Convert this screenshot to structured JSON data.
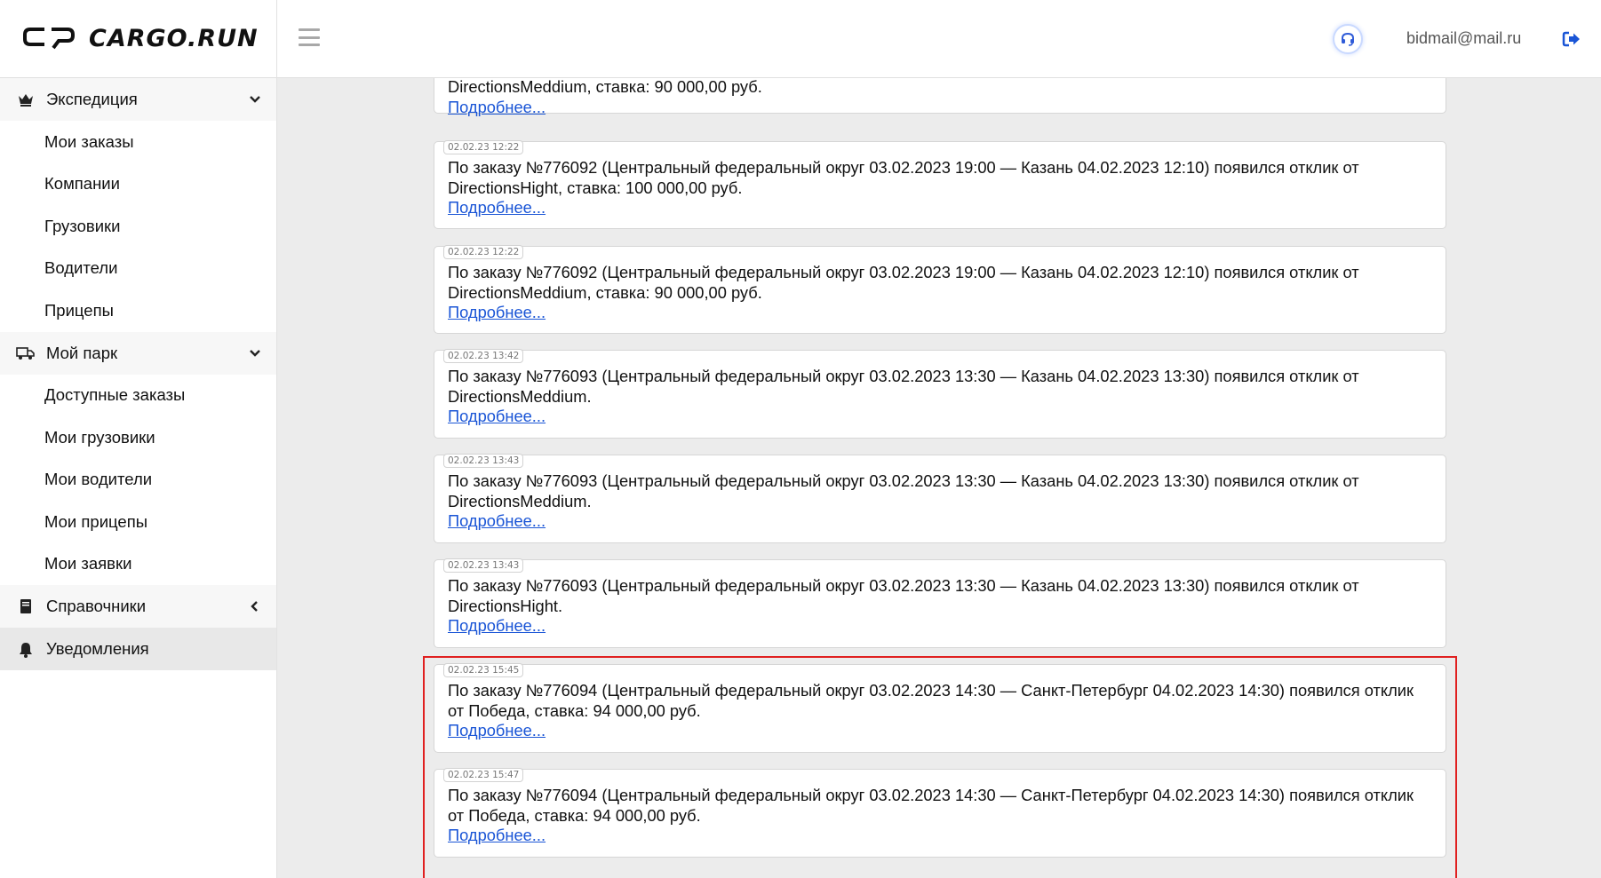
{
  "header": {
    "logo_text": "CARGO.RUN",
    "user_email": "bidmail@mail.ru",
    "icons": {
      "support": "headset-icon",
      "logout": "logout-icon",
      "menu": "hamburger-icon"
    }
  },
  "sidebar": {
    "groups": [
      {
        "label": "Экспедиция",
        "icon": "crown-icon",
        "chevron": "chevron-down",
        "items": [
          "Мои заказы",
          "Компании",
          "Грузовики",
          "Водители",
          "Прицепы"
        ]
      },
      {
        "label": "Мой парк",
        "icon": "truck-icon",
        "chevron": "chevron-down",
        "items": [
          "Доступные заказы",
          "Мои грузовики",
          "Мои водители",
          "Мои прицепы",
          "Мои заявки"
        ]
      },
      {
        "label": "Справочники",
        "icon": "book-icon",
        "chevron": "chevron-left"
      },
      {
        "label": "Уведомления",
        "icon": "bell-icon",
        "active": true
      }
    ]
  },
  "notifications": [
    {
      "timestamp": "",
      "text_line": "DirectionsMeddium, ставка: 90 000,00 руб.",
      "more": "Подробнее..."
    },
    {
      "timestamp": "02.02.23 12:22",
      "text": "По заказу №776092 (Центральный федеральный округ 03.02.2023 19:00 — Казань 04.02.2023 12:10) появился отклик от DirectionsHight, ставка: 100 000,00 руб.",
      "more": "Подробнее..."
    },
    {
      "timestamp": "02.02.23 12:22",
      "text": "По заказу №776092 (Центральный федеральный округ 03.02.2023 19:00 — Казань 04.02.2023 12:10) появился отклик от DirectionsMeddium, ставка: 90 000,00 руб.",
      "more": "Подробнее..."
    },
    {
      "timestamp": "02.02.23 13:42",
      "text": "По заказу №776093 (Центральный федеральный округ 03.02.2023 13:30 — Казань 04.02.2023 13:30) появился отклик от DirectionsMeddium.",
      "more": "Подробнее..."
    },
    {
      "timestamp": "02.02.23 13:43",
      "text": "По заказу №776093 (Центральный федеральный округ 03.02.2023 13:30 — Казань 04.02.2023 13:30) появился отклик от DirectionsMeddium.",
      "more": "Подробнее..."
    },
    {
      "timestamp": "02.02.23 13:43",
      "text": "По заказу №776093 (Центральный федеральный округ 03.02.2023 13:30 — Казань 04.02.2023 13:30) появился отклик от DirectionsHight.",
      "more": "Подробнее..."
    },
    {
      "timestamp": "02.02.23 15:45",
      "text": "По заказу №776094 (Центральный федеральный округ 03.02.2023 14:30 — Санкт-Петербург 04.02.2023 14:30) появился отклик от Победа, ставка: 94 000,00 руб.",
      "more": "Подробнее..."
    },
    {
      "timestamp": "02.02.23 15:47",
      "text": "По заказу №776094 (Центральный федеральный округ 03.02.2023 14:30 — Санкт-Петербург 04.02.2023 14:30) появился отклик от Победа, ставка: 94 000,00 руб.",
      "more": "Подробнее..."
    }
  ],
  "colors": {
    "accent": "#1a55d6",
    "highlight": "#e02020"
  }
}
